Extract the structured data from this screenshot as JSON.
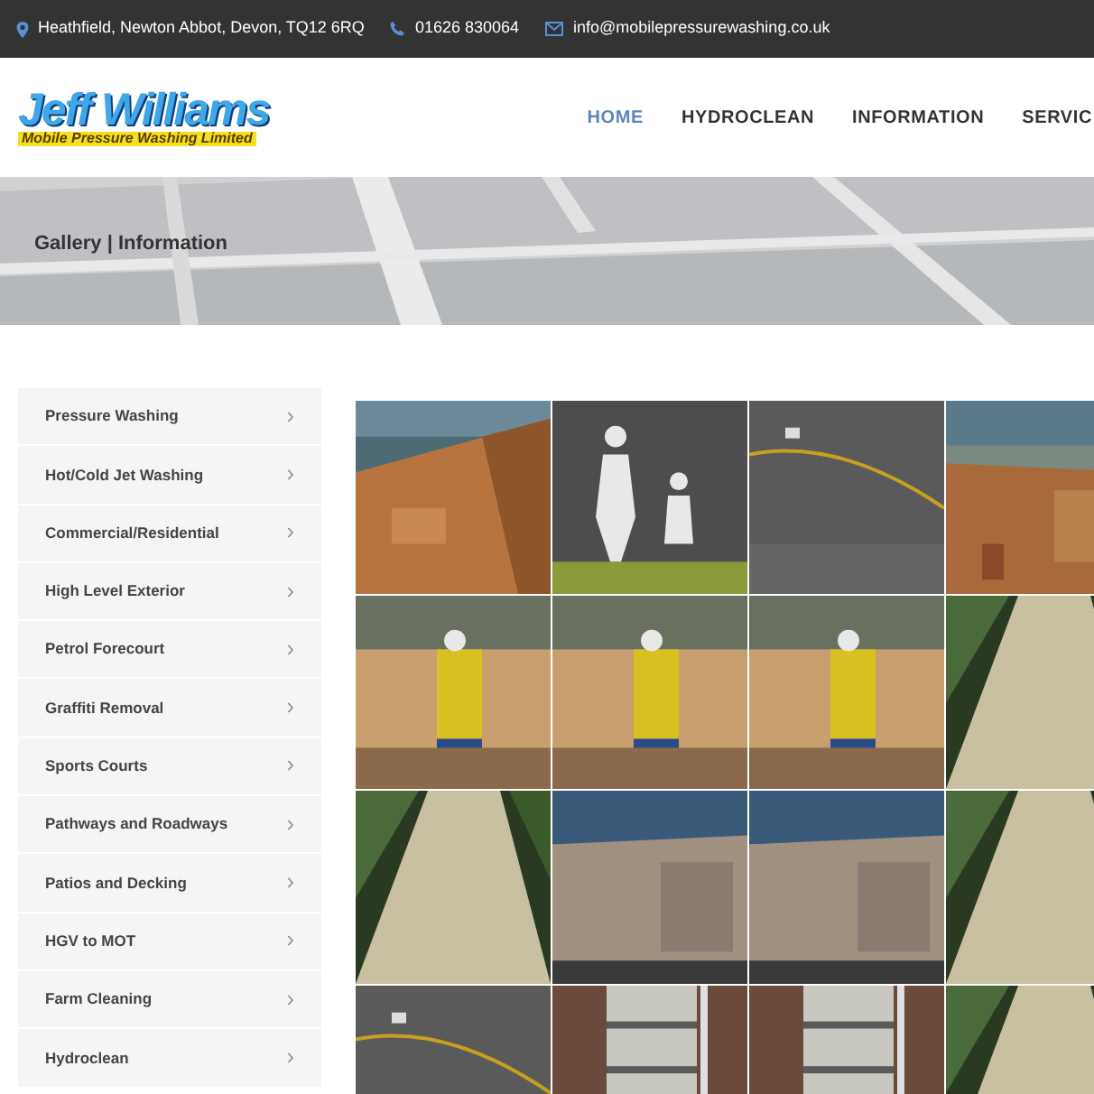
{
  "top_bar": {
    "address": "Heathfield, Newton Abbot, Devon, TQ12 6RQ",
    "phone": "01626 830064",
    "email": "info@mobilepressurewashing.co.uk"
  },
  "logo": {
    "title": "Jeff Williams",
    "subtitle": "Mobile Pressure Washing Limited"
  },
  "nav": [
    {
      "label": "HOME",
      "selected": true
    },
    {
      "label": "HYDROCLEAN",
      "selected": false
    },
    {
      "label": "INFORMATION",
      "selected": false
    },
    {
      "label": "SERVIC",
      "selected": false
    }
  ],
  "banner": {
    "title": "Gallery | Information"
  },
  "sidebar": {
    "items": [
      "Pressure Washing",
      "Hot/Cold Jet Washing",
      "Commercial/Residential",
      "High Level Exterior",
      "Petrol Forecourt",
      "Graffiti Removal",
      "Sports Courts",
      "Pathways and Roadways",
      "Patios and Decking",
      "HGV to MOT",
      "Farm Cleaning",
      "Hydroclean"
    ]
  }
}
